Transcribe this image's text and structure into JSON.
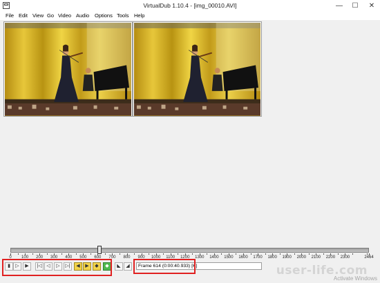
{
  "window": {
    "title": "VirtualDub 1.10.4 - [img_00010.AVI]",
    "minimize_glyph": "—",
    "maximize_glyph": "☐",
    "close_glyph": "✕"
  },
  "menu": {
    "items": [
      {
        "label": "File"
      },
      {
        "label": "Edit"
      },
      {
        "label": "View"
      },
      {
        "label": "Go"
      },
      {
        "label": "Video"
      },
      {
        "label": "Audio"
      },
      {
        "label": "Options"
      },
      {
        "label": "Tools"
      },
      {
        "label": "Help"
      }
    ]
  },
  "panes": {
    "input": {
      "name": "input-video-pane"
    },
    "output": {
      "name": "output-video-pane"
    }
  },
  "timeline": {
    "position_frame": 614,
    "total_frames": 2464,
    "tick_labels": [
      "0",
      "100",
      "200",
      "300",
      "400",
      "500",
      "600",
      "700",
      "800",
      "900",
      "1000",
      "1100",
      "1200",
      "1300",
      "1400",
      "1500",
      "1600",
      "1700",
      "1800",
      "1900",
      "2000",
      "2100",
      "2200",
      "2300",
      "2464"
    ]
  },
  "toolbar": {
    "buttons": [
      {
        "name": "stop-icon",
        "glyph": "▮",
        "style": "plain"
      },
      {
        "name": "play-input-icon",
        "glyph": "▷",
        "style": "plain"
      },
      {
        "name": "play-output-icon",
        "glyph": "▶",
        "style": "plain"
      },
      {
        "name": "go-start-icon",
        "glyph": "|◁",
        "style": "plain"
      },
      {
        "name": "step-back-icon",
        "glyph": "◁",
        "style": "plain"
      },
      {
        "name": "step-forward-icon",
        "glyph": "▷",
        "style": "plain"
      },
      {
        "name": "go-end-icon",
        "glyph": "▷|",
        "style": "plain"
      },
      {
        "name": "key-back-icon",
        "glyph": "◀",
        "style": "yellow"
      },
      {
        "name": "key-forward-icon",
        "glyph": "▶",
        "style": "yellow"
      },
      {
        "name": "scene-back-icon",
        "glyph": "◆",
        "style": "yellow"
      },
      {
        "name": "scene-forward-icon",
        "glyph": "◆",
        "style": "green"
      },
      {
        "name": "mark-in-icon",
        "glyph": "◣",
        "style": "plain"
      },
      {
        "name": "mark-out-icon",
        "glyph": "◢",
        "style": "plain"
      }
    ],
    "frame_status": "Frame 614 (0:00:40.933) [K]"
  },
  "watermark": {
    "site": "user-life.com",
    "activate": "Activate Windows"
  },
  "colors": {
    "highlight": "#e02020",
    "window_bg": "#f0f0f0"
  }
}
